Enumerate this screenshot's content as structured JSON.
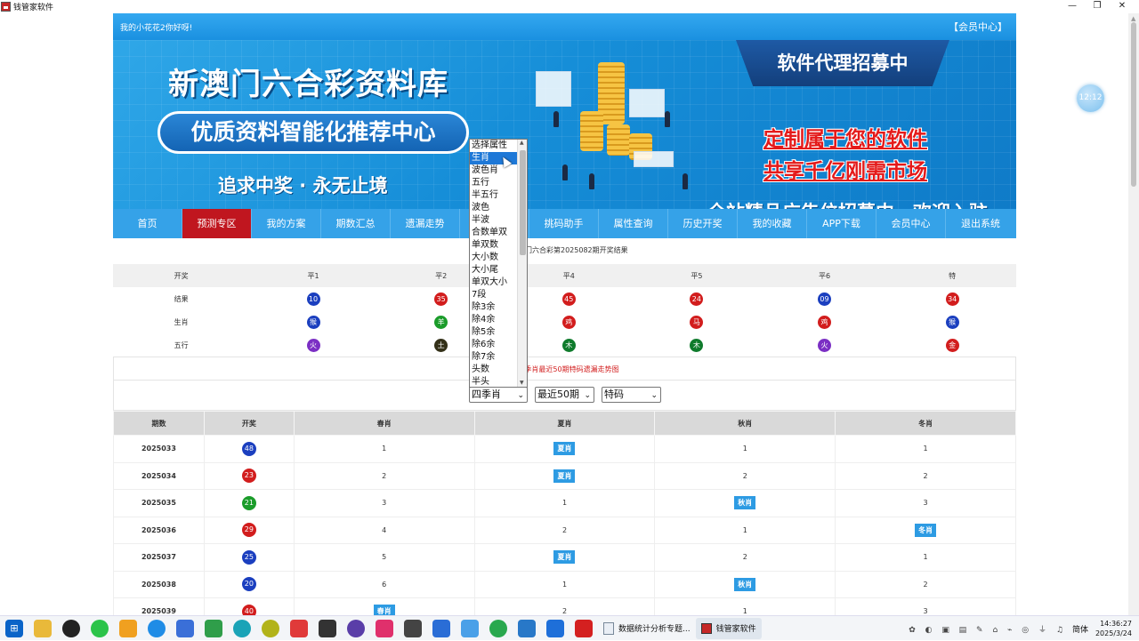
{
  "window": {
    "title": "钱管家软件",
    "controls": [
      "—",
      "❐",
      "✕"
    ]
  },
  "floating_clock": "12:12",
  "header": {
    "greeting": "我的小花花2你好呀!",
    "member_center": "【会员中心】"
  },
  "banner": {
    "title": "新澳门六合彩资料库",
    "pill": "优质资料智能化推荐中心",
    "slogan": "追求中奖 · 永无止境",
    "agent": "软件代理招募中",
    "red_line1": "定制属于您的软件",
    "red_line2": "共享千亿刚需市场",
    "ad": "全站精品广告位招募中，欢迎入驻"
  },
  "nav": [
    "首页",
    "预测专区",
    "我的方案",
    "期数汇总",
    "遗漏走势",
    "",
    "挑码助手",
    "属性查询",
    "历史开奖",
    "我的收藏",
    "APP下载",
    "会员中心",
    "退出系统"
  ],
  "nav_active": 1,
  "draw_title": "门六合彩第2025082期开奖结果",
  "result": {
    "headers": [
      "开奖",
      "平1",
      "平2",
      "",
      "平4",
      "平5",
      "平6",
      "特"
    ],
    "rows": [
      {
        "label": "结果",
        "cells": [
          {
            "t": "10",
            "c": "blue"
          },
          {
            "t": "35",
            "c": "red"
          },
          {
            "t": "",
            "c": ""
          },
          {
            "t": "45",
            "c": "red"
          },
          {
            "t": "24",
            "c": "red"
          },
          {
            "t": "09",
            "c": "blue"
          },
          {
            "t": "34",
            "c": "red"
          }
        ]
      },
      {
        "label": "生肖",
        "cells": [
          {
            "t": "猴",
            "c": "blue"
          },
          {
            "t": "羊",
            "c": "green"
          },
          {
            "t": "",
            "c": ""
          },
          {
            "t": "鸡",
            "c": "red"
          },
          {
            "t": "马",
            "c": "red"
          },
          {
            "t": "鸡",
            "c": "red"
          },
          {
            "t": "猴",
            "c": "blue"
          }
        ]
      },
      {
        "label": "五行",
        "cells": [
          {
            "t": "火",
            "c": "purple"
          },
          {
            "t": "土",
            "c": "dark"
          },
          {
            "t": "",
            "c": ""
          },
          {
            "t": "木",
            "c": "dkgreen"
          },
          {
            "t": "木",
            "c": "dkgreen"
          },
          {
            "t": "火",
            "c": "purple"
          },
          {
            "t": "金",
            "c": "red"
          }
        ]
      }
    ]
  },
  "trend_title": "彩四季肖最近50期特码遗漏走势图",
  "filters": {
    "attr": "四季肖",
    "range": "最近50期",
    "code": "特码"
  },
  "dropdown": {
    "options": [
      "选择属性",
      "生肖",
      "波色肖",
      "五行",
      "半五行",
      "波色",
      "半波",
      "合数单双",
      "单双数",
      "大小数",
      "大小尾",
      "单双大小",
      "7段",
      "除3余",
      "除4余",
      "除5余",
      "除6余",
      "除7余",
      "头数",
      "半头"
    ],
    "highlighted": 1
  },
  "trend": {
    "headers": [
      "期数",
      "开奖",
      "春肖",
      "夏肖",
      "秋肖",
      "冬肖"
    ],
    "rows": [
      {
        "period": "2025033",
        "ball": "48",
        "color": "blue",
        "cells": [
          "1",
          "夏肖",
          "1",
          "1"
        ]
      },
      {
        "period": "2025034",
        "ball": "23",
        "color": "red",
        "cells": [
          "2",
          "夏肖",
          "2",
          "2"
        ]
      },
      {
        "period": "2025035",
        "ball": "21",
        "color": "green",
        "cells": [
          "3",
          "1",
          "秋肖",
          "3"
        ]
      },
      {
        "period": "2025036",
        "ball": "29",
        "color": "red",
        "cells": [
          "4",
          "2",
          "1",
          "冬肖"
        ]
      },
      {
        "period": "2025037",
        "ball": "25",
        "color": "blue",
        "cells": [
          "5",
          "夏肖",
          "2",
          "1"
        ]
      },
      {
        "period": "2025038",
        "ball": "20",
        "color": "blue",
        "cells": [
          "6",
          "1",
          "秋肖",
          "2"
        ]
      },
      {
        "period": "2025039",
        "ball": "40",
        "color": "red",
        "cells": [
          "春肖",
          "2",
          "1",
          "3"
        ]
      }
    ]
  },
  "taskbar": {
    "tasks": [
      "数据统计分析专题...",
      "钱管家软件"
    ],
    "tray_lang": "简体",
    "time": "14:36:27",
    "date": "2025/3/24"
  }
}
